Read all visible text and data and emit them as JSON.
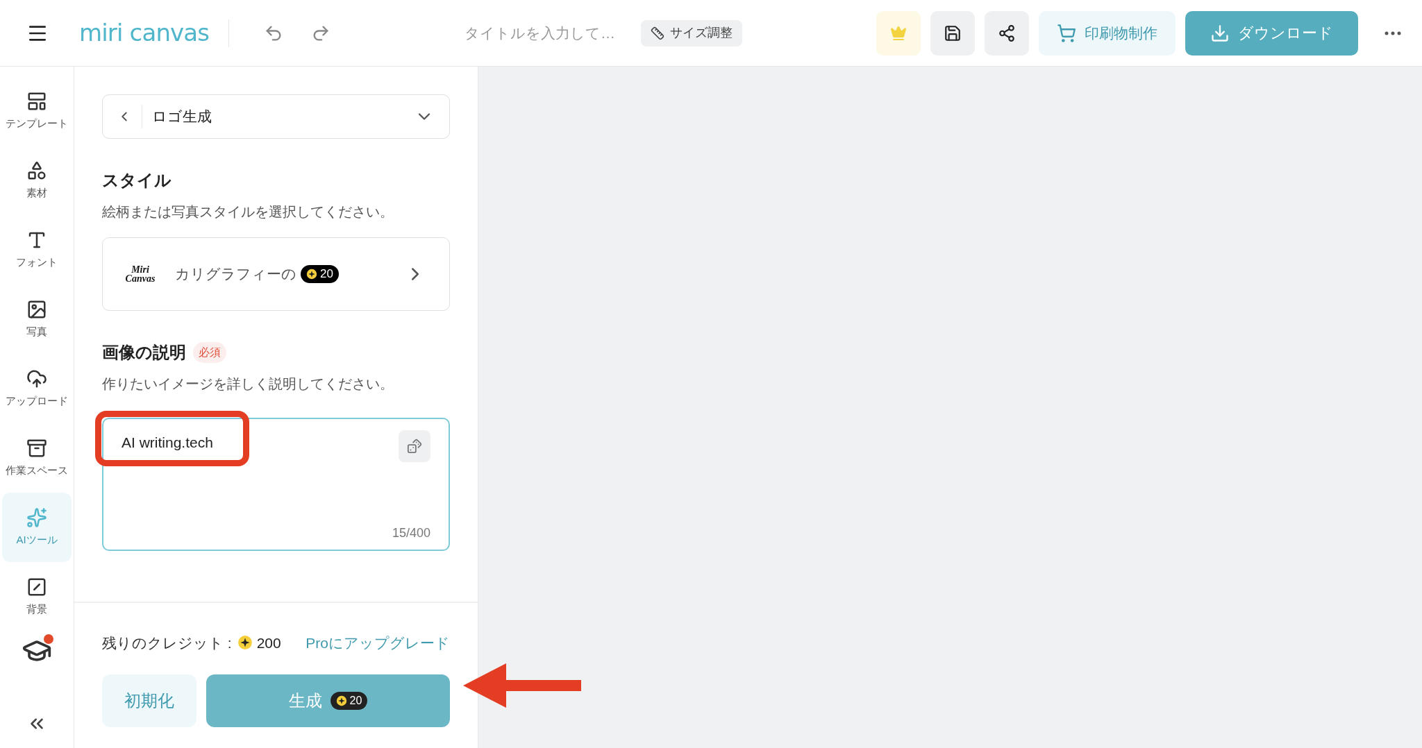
{
  "header": {
    "logo": "miri canvas",
    "title_placeholder": "タイトルを入力して…",
    "resize_button": "サイズ調整",
    "print_button": "印刷物制作",
    "download_button": "ダウンロード"
  },
  "sidebar": {
    "items": [
      {
        "kind": "template",
        "label": "テンプレート",
        "selected": false
      },
      {
        "kind": "elements",
        "label": "素材",
        "selected": false
      },
      {
        "kind": "text",
        "label": "フォント",
        "selected": false
      },
      {
        "kind": "photo",
        "label": "写真",
        "selected": false
      },
      {
        "kind": "upload",
        "label": "アップロード",
        "selected": false
      },
      {
        "kind": "workspace",
        "label": "作業スペース",
        "selected": false
      },
      {
        "kind": "ai",
        "label": "AIツール",
        "selected": true
      },
      {
        "kind": "background",
        "label": "背景",
        "selected": false
      }
    ],
    "learn_badge": true
  },
  "panel": {
    "tool_select": "ロゴ生成",
    "style_heading": "スタイル",
    "style_hint": "絵柄または写真スタイルを選択してください。",
    "style_card": {
      "logo": "Miri Canvas",
      "name": "カリグラフィーの",
      "cost": "20"
    },
    "description_heading": "画像の説明",
    "required_badge": "必須",
    "description_hint": "作りたいイメージを詳しく説明してください。",
    "description_value": "AI writing.tech",
    "char_count": "15/400",
    "credits_label": "残りのクレジット :",
    "credits_value": "200",
    "upgrade_link": "Proにアップグレード",
    "reset_button": "初期化",
    "generate_button": "生成",
    "generate_cost": "20"
  }
}
